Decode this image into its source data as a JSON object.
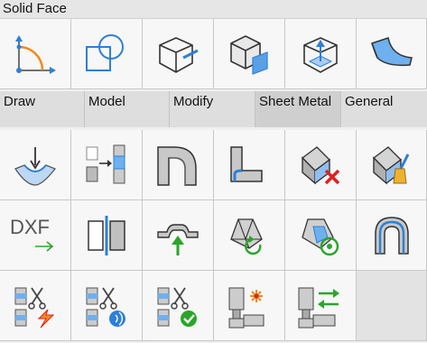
{
  "panel": {
    "title": "Solid Face"
  },
  "tabs": [
    {
      "label": "Draw",
      "active": false
    },
    {
      "label": "Model",
      "active": false
    },
    {
      "label": "Modify",
      "active": false
    },
    {
      "label": "Sheet Metal",
      "active": true
    },
    {
      "label": "General",
      "active": false
    }
  ],
  "rows": [
    {
      "tools": [
        {
          "name": "arc-corner-tool",
          "icon": "arc-corner-icon"
        },
        {
          "name": "square-circle-tool",
          "icon": "square-circle-icon"
        },
        {
          "name": "box-extrude-tool",
          "icon": "box-extrude-icon"
        },
        {
          "name": "box-face-tool",
          "icon": "box-face-icon"
        },
        {
          "name": "box-arrow-tool",
          "icon": "box-arrow-icon"
        },
        {
          "name": "curved-face-tool",
          "icon": "curved-face-icon"
        }
      ]
    },
    {
      "tools": [
        {
          "name": "bend-tool",
          "icon": "bend-icon"
        },
        {
          "name": "junction-tool",
          "icon": "junction-icon"
        },
        {
          "name": "flange-corner-tool",
          "icon": "flange-corner-icon"
        },
        {
          "name": "l-flange-tool",
          "icon": "l-flange-icon"
        },
        {
          "name": "delete-feature-tool",
          "icon": "delete-feature-icon"
        },
        {
          "name": "repair-tool",
          "icon": "repair-brush-icon"
        }
      ]
    },
    {
      "tools": [
        {
          "name": "dxf-export-tool",
          "icon": "dxf-export-icon",
          "text": "DXF"
        },
        {
          "name": "split-tool",
          "icon": "split-icon"
        },
        {
          "name": "lift-flange-tool",
          "icon": "lift-flange-icon"
        },
        {
          "name": "unfold-tool",
          "icon": "unfold-icon"
        },
        {
          "name": "refold-tool",
          "icon": "refold-icon"
        },
        {
          "name": "u-bend-tool",
          "icon": "u-bend-icon"
        }
      ]
    },
    {
      "tools": [
        {
          "name": "rip-lightning-tool",
          "icon": "rip-lightning-icon"
        },
        {
          "name": "rip-sound-tool",
          "icon": "rip-sound-icon"
        },
        {
          "name": "rip-check-tool",
          "icon": "rip-check-icon"
        },
        {
          "name": "junction-spark-tool",
          "icon": "junction-spark-icon"
        },
        {
          "name": "junction-swap-tool",
          "icon": "junction-swap-icon"
        }
      ]
    }
  ],
  "colors": {
    "blue": "#2d7fd6",
    "green": "#2aa52a",
    "red": "#e02020",
    "orange": "#f08a1a"
  }
}
